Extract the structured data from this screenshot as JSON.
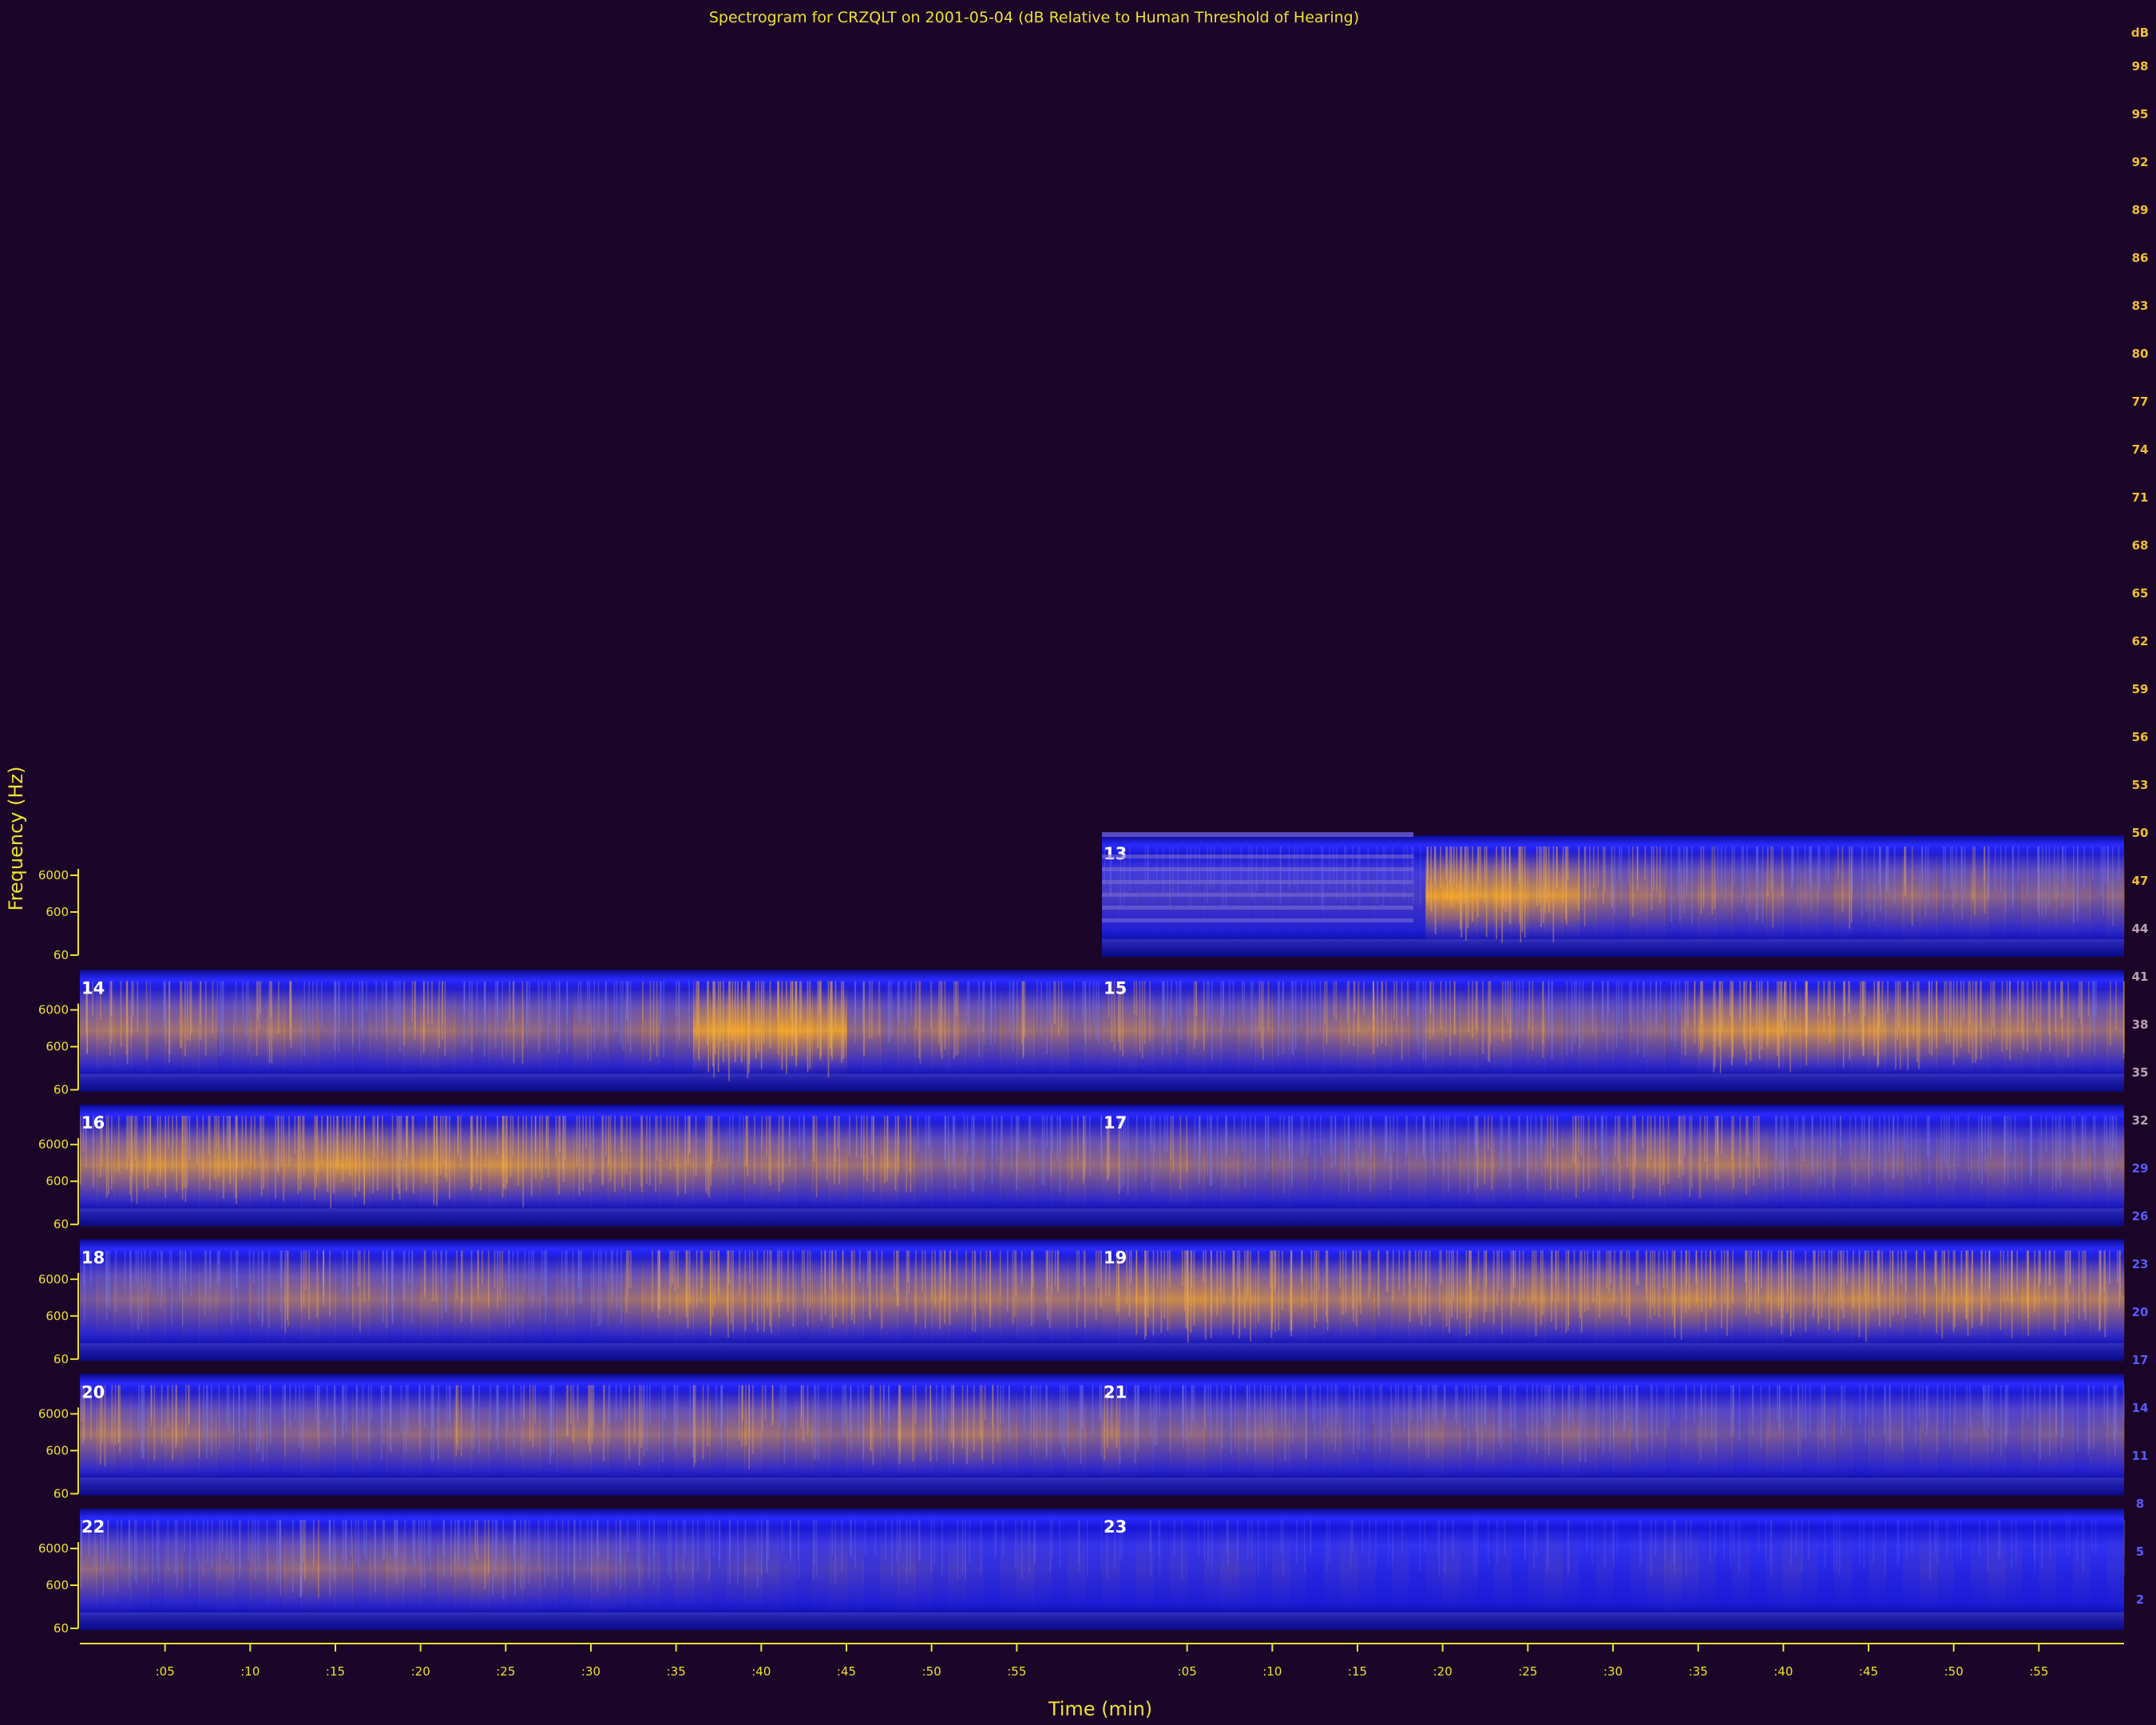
{
  "chart_data": {
    "type": "heatmap",
    "title": "Spectrogram for CRZQLT on 2001-05-04 (dB Relative to Human Threshold of Hearing)",
    "xlabel": "Time (min)",
    "ylabel": "Frequency (Hz)",
    "y_tick_labels": [
      "6000",
      "600",
      "60"
    ],
    "x_tick_labels": [
      ":05",
      ":10",
      ":15",
      ":20",
      ":25",
      ":30",
      ":35",
      ":40",
      ":45",
      ":50",
      ":55"
    ],
    "color_scale": {
      "unit_label": "dB",
      "values": [
        98,
        95,
        92,
        89,
        86,
        83,
        80,
        77,
        74,
        71,
        68,
        65,
        62,
        59,
        56,
        53,
        50,
        47,
        44,
        41,
        38,
        35,
        32,
        29,
        26,
        23,
        20,
        17,
        14,
        11,
        8,
        5,
        2
      ]
    },
    "hours": [
      {
        "label": "13",
        "intensity": [
          0.15,
          0.15,
          0.15,
          0.15,
          0.15,
          0.15,
          0.15,
          0.15,
          0.15,
          0.15,
          0.15,
          0.15,
          0.15,
          0.15,
          0.15,
          0.15,
          0.15,
          0.15,
          0.15,
          0.9,
          0.95,
          0.9,
          0.85,
          0.9,
          0.85,
          0.8,
          0.85,
          0.8,
          0.6,
          0.55,
          0.5,
          0.6,
          0.55,
          0.45,
          0.5,
          0.55,
          0.5,
          0.45,
          0.5,
          0.55,
          0.45,
          0.5,
          0.45,
          0.55,
          0.4,
          0.45,
          0.5,
          0.55,
          0.5,
          0.45,
          0.5,
          0.55,
          0.45,
          0.4,
          0.45,
          0.5,
          0.5,
          0.45,
          0.4,
          0.5
        ]
      },
      {
        "label": "14",
        "intensity": [
          0.55,
          0.6,
          0.6,
          0.55,
          0.5,
          0.55,
          0.6,
          0.55,
          0.45,
          0.5,
          0.55,
          0.6,
          0.55,
          0.5,
          0.45,
          0.4,
          0.4,
          0.45,
          0.5,
          0.55,
          0.6,
          0.55,
          0.5,
          0.45,
          0.5,
          0.55,
          0.5,
          0.45,
          0.4,
          0.5,
          0.45,
          0.4,
          0.5,
          0.55,
          0.45,
          0.5,
          0.85,
          0.9,
          0.95,
          0.9,
          0.85,
          0.95,
          0.9,
          0.85,
          0.9,
          0.5,
          0.55,
          0.45,
          0.5,
          0.55,
          0.6,
          0.55,
          0.5,
          0.45,
          0.5,
          0.55,
          0.5,
          0.55,
          0.45,
          0.5
        ]
      },
      {
        "label": "15",
        "intensity": [
          0.55,
          0.6,
          0.55,
          0.5,
          0.45,
          0.55,
          0.5,
          0.45,
          0.5,
          0.55,
          0.5,
          0.45,
          0.5,
          0.55,
          0.6,
          0.65,
          0.6,
          0.55,
          0.5,
          0.6,
          0.55,
          0.6,
          0.55,
          0.6,
          0.5,
          0.55,
          0.5,
          0.45,
          0.5,
          0.45,
          0.4,
          0.45,
          0.5,
          0.45,
          0.6,
          0.75,
          0.8,
          0.75,
          0.8,
          0.85,
          0.8,
          0.75,
          0.8,
          0.7,
          0.75,
          0.8,
          0.7,
          0.75,
          0.7,
          0.65,
          0.7,
          0.65,
          0.6,
          0.65,
          0.6,
          0.55,
          0.6,
          0.55,
          0.5,
          0.55
        ]
      },
      {
        "label": "16",
        "intensity": [
          0.6,
          0.65,
          0.7,
          0.75,
          0.8,
          0.75,
          0.7,
          0.75,
          0.8,
          0.75,
          0.7,
          0.65,
          0.7,
          0.75,
          0.8,
          0.85,
          0.8,
          0.75,
          0.7,
          0.75,
          0.8,
          0.75,
          0.7,
          0.75,
          0.8,
          0.75,
          0.7,
          0.65,
          0.7,
          0.65,
          0.6,
          0.65,
          0.6,
          0.55,
          0.6,
          0.65,
          0.6,
          0.55,
          0.5,
          0.55,
          0.6,
          0.55,
          0.5,
          0.55,
          0.6,
          0.55,
          0.6,
          0.65,
          0.55,
          0.5,
          0.45,
          0.5,
          0.45,
          0.4,
          0.45,
          0.5,
          0.45,
          0.5,
          0.55,
          0.5
        ]
      },
      {
        "label": "17",
        "intensity": [
          0.55,
          0.5,
          0.45,
          0.5,
          0.55,
          0.5,
          0.45,
          0.5,
          0.45,
          0.4,
          0.45,
          0.4,
          0.35,
          0.4,
          0.45,
          0.5,
          0.45,
          0.4,
          0.45,
          0.4,
          0.45,
          0.5,
          0.55,
          0.5,
          0.45,
          0.5,
          0.55,
          0.6,
          0.55,
          0.5,
          0.55,
          0.6,
          0.65,
          0.6,
          0.55,
          0.6,
          0.65,
          0.6,
          0.55,
          0.5,
          0.45,
          0.5,
          0.45,
          0.4,
          0.45,
          0.4,
          0.45,
          0.4,
          0.35,
          0.4,
          0.35,
          0.4,
          0.45,
          0.4,
          0.35,
          0.4,
          0.45,
          0.5,
          0.45,
          0.5
        ]
      },
      {
        "label": "18",
        "intensity": [
          0.35,
          0.4,
          0.45,
          0.5,
          0.45,
          0.4,
          0.45,
          0.5,
          0.45,
          0.4,
          0.45,
          0.5,
          0.55,
          0.6,
          0.55,
          0.5,
          0.55,
          0.5,
          0.45,
          0.5,
          0.55,
          0.5,
          0.55,
          0.6,
          0.55,
          0.5,
          0.45,
          0.4,
          0.45,
          0.4,
          0.45,
          0.5,
          0.55,
          0.6,
          0.65,
          0.7,
          0.65,
          0.7,
          0.65,
          0.6,
          0.65,
          0.6,
          0.55,
          0.6,
          0.65,
          0.6,
          0.55,
          0.6,
          0.55,
          0.6,
          0.65,
          0.6,
          0.55,
          0.6,
          0.55,
          0.6,
          0.55,
          0.6,
          0.55,
          0.6
        ]
      },
      {
        "label": "19",
        "intensity": [
          0.65,
          0.7,
          0.75,
          0.7,
          0.75,
          0.8,
          0.75,
          0.7,
          0.75,
          0.7,
          0.65,
          0.7,
          0.65,
          0.6,
          0.65,
          0.6,
          0.55,
          0.6,
          0.65,
          0.6,
          0.65,
          0.7,
          0.65,
          0.6,
          0.65,
          0.7,
          0.65,
          0.6,
          0.65,
          0.7,
          0.65,
          0.6,
          0.65,
          0.7,
          0.75,
          0.7,
          0.65,
          0.6,
          0.65,
          0.7,
          0.65,
          0.6,
          0.65,
          0.7,
          0.75,
          0.7,
          0.65,
          0.6,
          0.65,
          0.7,
          0.75,
          0.7,
          0.65,
          0.7,
          0.75,
          0.7,
          0.65,
          0.6,
          0.65,
          0.6
        ]
      },
      {
        "label": "20",
        "intensity": [
          0.55,
          0.6,
          0.55,
          0.5,
          0.55,
          0.6,
          0.55,
          0.5,
          0.45,
          0.4,
          0.45,
          0.4,
          0.45,
          0.5,
          0.45,
          0.4,
          0.45,
          0.4,
          0.45,
          0.5,
          0.45,
          0.5,
          0.55,
          0.5,
          0.45,
          0.5,
          0.55,
          0.5,
          0.55,
          0.6,
          0.55,
          0.5,
          0.55,
          0.5,
          0.45,
          0.5,
          0.55,
          0.5,
          0.55,
          0.6,
          0.55,
          0.5,
          0.55,
          0.5,
          0.45,
          0.5,
          0.55,
          0.5,
          0.6,
          0.55,
          0.5,
          0.55,
          0.6,
          0.55,
          0.5,
          0.45,
          0.5,
          0.45,
          0.5,
          0.45
        ]
      },
      {
        "label": "21",
        "intensity": [
          0.6,
          0.5,
          0.45,
          0.4,
          0.45,
          0.5,
          0.45,
          0.4,
          0.45,
          0.5,
          0.45,
          0.4,
          0.35,
          0.4,
          0.35,
          0.3,
          0.35,
          0.4,
          0.45,
          0.5,
          0.45,
          0.4,
          0.45,
          0.4,
          0.35,
          0.4,
          0.45,
          0.5,
          0.45,
          0.4,
          0.45,
          0.4,
          0.35,
          0.3,
          0.35,
          0.4,
          0.35,
          0.3,
          0.35,
          0.4,
          0.35,
          0.3,
          0.35,
          0.3,
          0.25,
          0.3,
          0.35,
          0.3,
          0.35,
          0.3,
          0.35,
          0.4,
          0.35,
          0.3,
          0.35,
          0.4,
          0.35,
          0.3,
          0.35,
          0.4
        ]
      },
      {
        "label": "22",
        "intensity": [
          0.5,
          0.45,
          0.4,
          0.35,
          0.3,
          0.35,
          0.3,
          0.35,
          0.4,
          0.35,
          0.4,
          0.45,
          0.5,
          0.55,
          0.5,
          0.45,
          0.4,
          0.45,
          0.5,
          0.45,
          0.4,
          0.45,
          0.5,
          0.55,
          0.5,
          0.45,
          0.4,
          0.35,
          0.3,
          0.35,
          0.4,
          0.35,
          0.3,
          0.25,
          0.2,
          0.25,
          0.2,
          0.15,
          0.2,
          0.25,
          0.2,
          0.15,
          0.1,
          0.15,
          0.2,
          0.15,
          0.1,
          0.15,
          0.2,
          0.15,
          0.1,
          0.15,
          0.1,
          0.05,
          0.1,
          0.15,
          0.1,
          0.05,
          0.1,
          0.05
        ]
      },
      {
        "label": "23",
        "intensity": [
          0.1,
          0.05,
          0.1,
          0.05,
          0.1,
          0.05,
          0.1,
          0.15,
          0.1,
          0.05,
          0.1,
          0.05,
          0.0,
          0.05,
          0.1,
          0.05,
          0.0,
          0.05,
          0.0,
          0.05,
          0.1,
          0.05,
          0.0,
          0.05,
          0.0,
          0.05,
          0.1,
          0.05,
          0.0,
          0.05,
          0.0,
          0.05,
          0.1,
          0.15,
          0.1,
          0.05,
          0.0,
          0.05,
          0.0,
          0.05,
          0.1,
          0.05,
          0.0,
          0.05,
          0.0,
          0.05,
          0.0,
          0.05,
          0.1,
          0.05,
          0.0,
          0.05,
          0.1,
          0.05,
          0.0,
          0.05,
          0.0,
          0.05,
          0.0,
          0.05
        ]
      }
    ]
  }
}
